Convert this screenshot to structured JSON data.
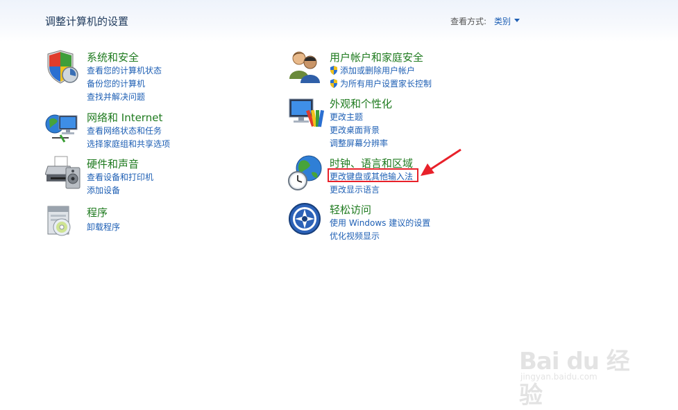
{
  "header": {
    "title": "调整计算机的设置",
    "view_by_label": "查看方式:",
    "view_by_value": "类别"
  },
  "categories_left": [
    {
      "title": "系统和安全",
      "icon": "shield-icon",
      "links": [
        "查看您的计算机状态",
        "备份您的计算机",
        "查找并解决问题"
      ]
    },
    {
      "title": "网络和 Internet",
      "icon": "network-icon",
      "links": [
        "查看网络状态和任务",
        "选择家庭组和共享选项"
      ]
    },
    {
      "title": "硬件和声音",
      "icon": "printer-icon",
      "links": [
        "查看设备和打印机",
        "添加设备"
      ]
    },
    {
      "title": "程序",
      "icon": "programs-icon",
      "links": [
        "卸载程序"
      ]
    }
  ],
  "categories_right": [
    {
      "title": "用户帐户和家庭安全",
      "icon": "users-icon",
      "links": [
        "添加或删除用户帐户",
        "为所有用户设置家长控制"
      ]
    },
    {
      "title": "外观和个性化",
      "icon": "display-icon",
      "links": [
        "更改主题",
        "更改桌面背景",
        "调整屏幕分辨率"
      ]
    },
    {
      "title": "时钟、语言和区域",
      "icon": "globe-clock-icon",
      "links": [
        "更改键盘或其他输入法",
        "更改显示语言"
      ]
    },
    {
      "title": "轻松访问",
      "icon": "ease-of-access-icon",
      "links": [
        "使用 Windows 建议的设置",
        "优化视频显示"
      ]
    }
  ],
  "watermark": {
    "brand": "Bai  du 经验",
    "url": "jingyan.baidu.com"
  },
  "colors": {
    "link": "#1e5fb4",
    "category": "#1e7a1e",
    "annotation": "#e8212a"
  }
}
